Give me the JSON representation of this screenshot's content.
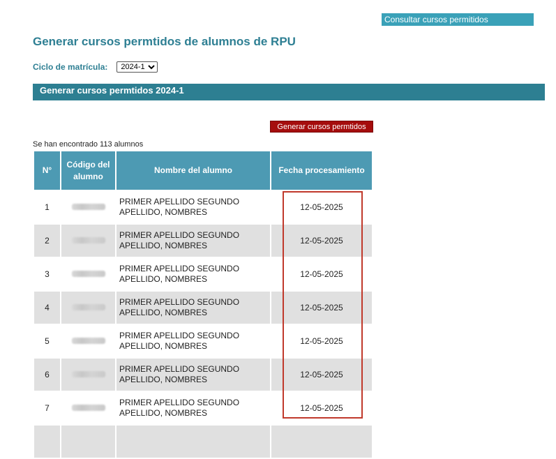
{
  "header": {
    "link_label": "Consultar cursos permitidos",
    "title": "Generar cursos permtidos de alumnos de RPU"
  },
  "cycle": {
    "label": "Ciclo de matrícula:",
    "selected": "2024-1"
  },
  "section": {
    "title": "Generar cursos permtidos 2024-1"
  },
  "actions": {
    "generate_label": "Generar cursos permtidos"
  },
  "results": {
    "count_text": "Se han encontrado 113 alumnos"
  },
  "table": {
    "columns": [
      "N°",
      "Código del alumno",
      "Nombre del alumno",
      "Fecha procesamiento"
    ],
    "rows": [
      {
        "num": "1",
        "name": "PRIMER APELLIDO SEGUNDO APELLIDO, NOMBRES",
        "date": "12-05-2025"
      },
      {
        "num": "2",
        "name": "PRIMER APELLIDO SEGUNDO APELLIDO, NOMBRES",
        "date": "12-05-2025"
      },
      {
        "num": "3",
        "name": "PRIMER APELLIDO SEGUNDO APELLIDO, NOMBRES",
        "date": "12-05-2025"
      },
      {
        "num": "4",
        "name": "PRIMER APELLIDO SEGUNDO APELLIDO, NOMBRES",
        "date": "12-05-2025"
      },
      {
        "num": "5",
        "name": "PRIMER APELLIDO SEGUNDO APELLIDO, NOMBRES",
        "date": "12-05-2025"
      },
      {
        "num": "6",
        "name": "PRIMER APELLIDO SEGUNDO APELLIDO, NOMBRES",
        "date": "12-05-2025"
      },
      {
        "num": "7",
        "name": "PRIMER APELLIDO SEGUNDO APELLIDO, NOMBRES",
        "date": "12-05-2025"
      },
      {
        "num": "",
        "name": "",
        "date": ""
      }
    ]
  },
  "colors": {
    "accent": "#2d7f92",
    "header_cell": "#4d9ab3",
    "link_bg": "#3aa1b8",
    "button_bg": "#a50d0d",
    "highlight_border": "#c0392b",
    "row_alt": "#e0e0e0"
  }
}
